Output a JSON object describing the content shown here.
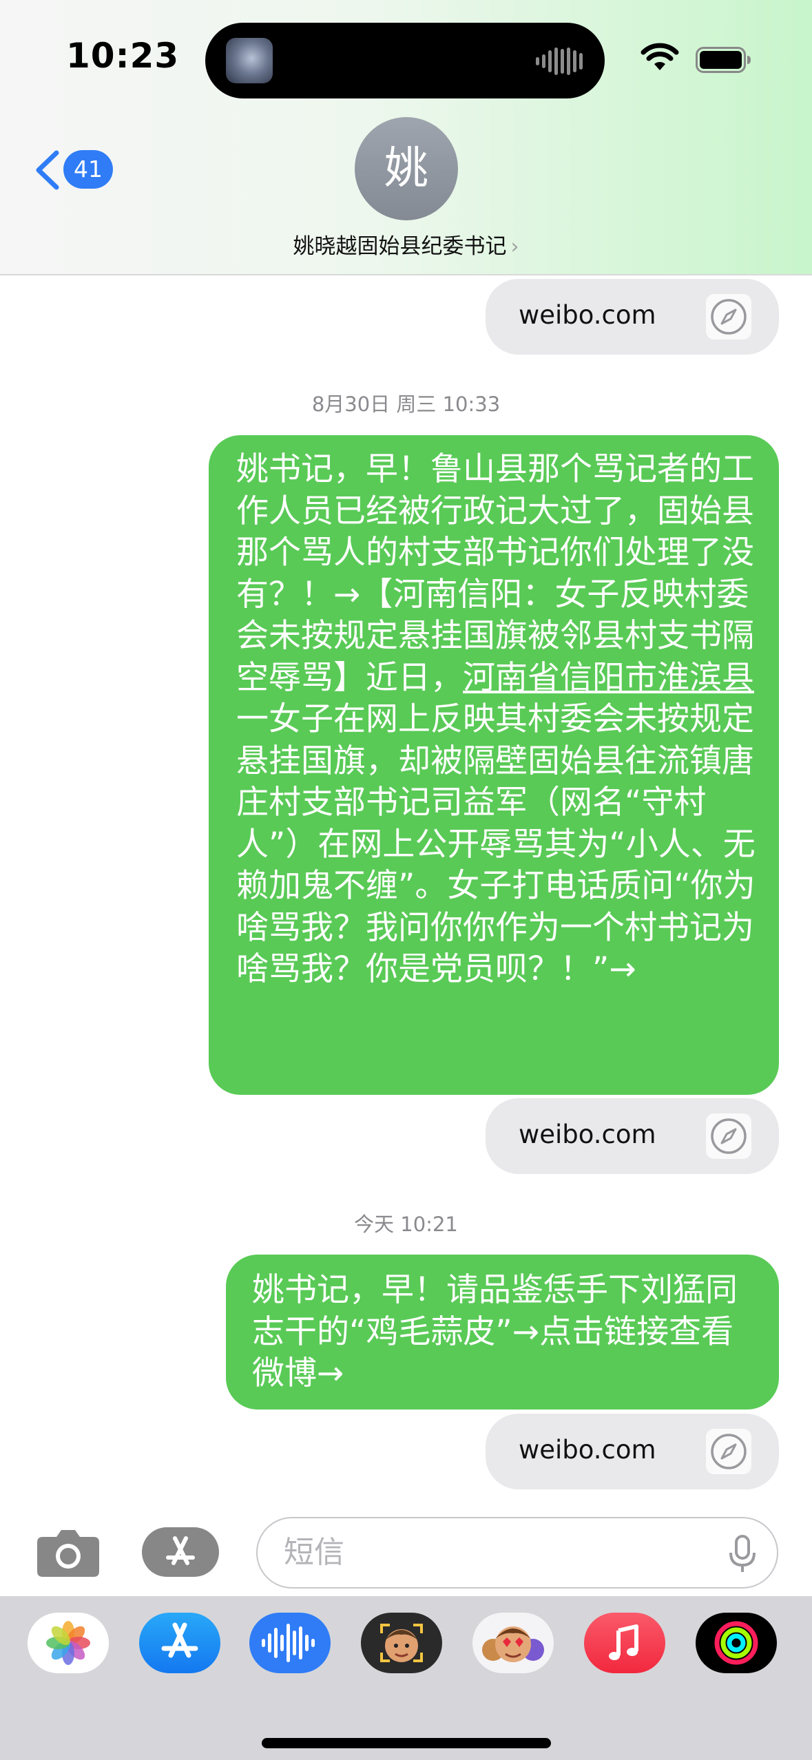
{
  "status_bar": {
    "time": "10:23"
  },
  "header": {
    "back_count": "41",
    "avatar_initial": "姚",
    "contact_name": "姚晓越固始县纪委书记",
    "contact_chevron": "›"
  },
  "messages": [
    {
      "type": "link",
      "domain": "weibo.com",
      "icon": "compass-icon"
    },
    {
      "type": "timestamp",
      "text": "8月30日 周三 10:33"
    },
    {
      "type": "outgoing",
      "text_before": "姚书记，早！鲁山县那个骂记者的工作人员已经被行政记大过了，固始县那个骂人的村支部书记你们处理了没有？！→【河南信阳：女子反映村委会未按规定悬挂国旗被邻县村支书隔空辱骂】近日，",
      "text_link": "河南省信阳市淮滨县",
      "text_after": "一女子在网上反映其村委会未按规定悬挂国旗，却被隔壁固始县往流镇唐庄村支部书记司益军（网名“守村人”）在网上公开辱骂其为“小人、无赖加鬼不缠”。女子打电话质问“你为啥骂我？我问你你作为一个村书记为啥骂我？你是党员呗？！”→"
    },
    {
      "type": "link",
      "domain": "weibo.com",
      "icon": "compass-icon"
    },
    {
      "type": "timestamp",
      "text": "今天 10:21"
    },
    {
      "type": "outgoing",
      "text": "姚书记，早！请品鉴恁手下刘猛同志干的“鸡毛蒜皮”→点击链接查看微博→"
    },
    {
      "type": "link",
      "domain": "weibo.com",
      "icon": "compass-icon"
    }
  ],
  "input_bar": {
    "placeholder": "短信"
  },
  "app_drawer": {
    "apps": [
      "photos-icon",
      "app-store-icon",
      "audio-message-icon",
      "memoji-icon",
      "memoji-stickers-icon",
      "music-icon",
      "fitness-icon"
    ]
  },
  "colors": {
    "outgoing_bubble": "#59ca56",
    "link_bubble": "#e9e9eb",
    "badge": "#2f7cf6",
    "accent_blue": "#2f7cf6"
  }
}
